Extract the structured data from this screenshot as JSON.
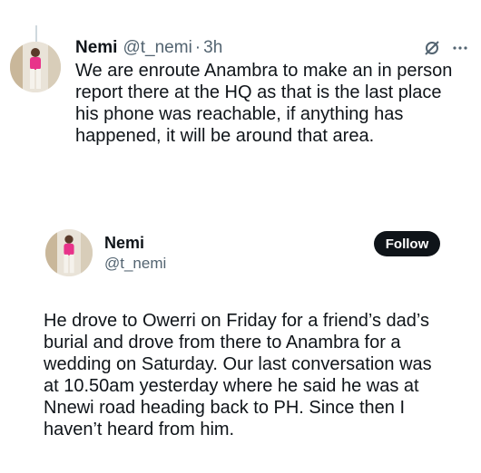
{
  "quoted_tweet": {
    "author_name": "Nemi",
    "handle": "@t_nemi",
    "separator": "·",
    "time": "3h",
    "text": "We are enroute Anambra to make an in person\nreport there at the HQ as that is the last place\nhis phone was reachable, if anything has\nhappened, it will be around that area.",
    "icons": [
      "grok-icon",
      "more-icon"
    ]
  },
  "tweet": {
    "author_name": "Nemi",
    "handle": "@t_nemi",
    "follow_label": "Follow",
    "text": "He drove to Owerri on Friday for a friend’s dad’s\nburial and drove from there to Anambra for a\nwedding on Saturday. Our last conversation was\nat 10.50am yesterday where he said he was at\nNnewi road heading back to PH. Since then I\nhaven’t heard from him."
  },
  "colors": {
    "text": "#0f1419",
    "secondary": "#536471",
    "button_bg": "#0f1419",
    "button_text": "#ffffff",
    "avatar_outfit": "#e8338a"
  }
}
